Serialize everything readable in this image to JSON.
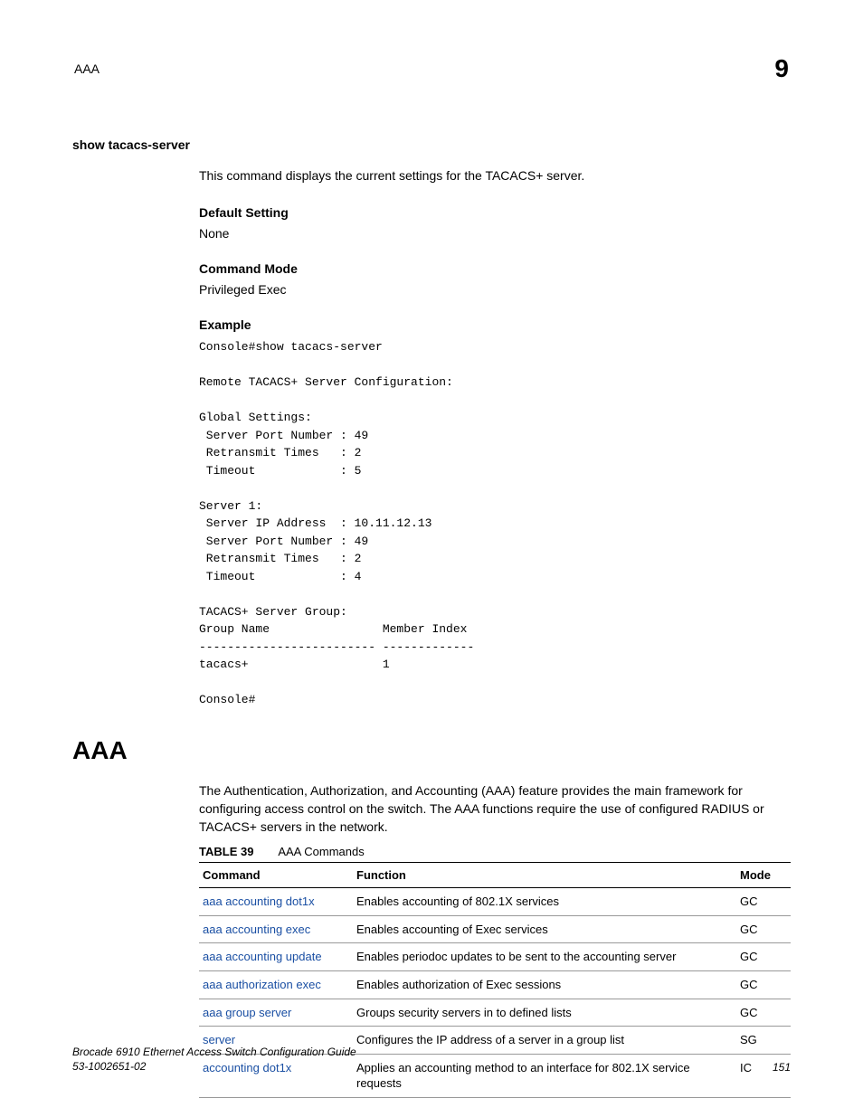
{
  "header": {
    "left": "AAA",
    "right": "9"
  },
  "command": {
    "name": "show tacacs-server",
    "intro": "This command displays the current settings for the TACACS+ server.",
    "default_setting_label": "Default Setting",
    "default_setting_value": "None",
    "command_mode_label": "Command Mode",
    "command_mode_value": "Privileged Exec",
    "example_label": "Example",
    "example_code": "Console#show tacacs-server\n\nRemote TACACS+ Server Configuration:\n\nGlobal Settings:\n Server Port Number : 49\n Retransmit Times   : 2\n Timeout            : 5\n\nServer 1:\n Server IP Address  : 10.11.12.13\n Server Port Number : 49\n Retransmit Times   : 2\n Timeout            : 4\n\nTACACS+ Server Group:\nGroup Name                Member Index\n------------------------- -------------\ntacacs+                   1\n\nConsole#"
  },
  "section": {
    "heading": "AAA",
    "intro": "The Authentication, Authorization, and Accounting (AAA) feature provides the main framework for configuring access control on the switch. The AAA functions require the use of configured RADIUS or TACACS+ servers in the network."
  },
  "table": {
    "caption_label": "TABLE 39",
    "caption_text": "AAA Commands",
    "headers": {
      "command": "Command",
      "function": "Function",
      "mode": "Mode"
    },
    "rows": [
      {
        "command": "aaa accounting dot1x",
        "function": "Enables accounting of 802.1X services",
        "mode": "GC"
      },
      {
        "command": "aaa accounting exec",
        "function": "Enables accounting of Exec services",
        "mode": "GC"
      },
      {
        "command": "aaa accounting update",
        "function": "Enables periodoc updates to be sent to the accounting server",
        "mode": "GC"
      },
      {
        "command": "aaa authorization exec",
        "function": "Enables authorization of Exec sessions",
        "mode": "GC"
      },
      {
        "command": "aaa group server",
        "function": "Groups security servers in to defined lists",
        "mode": "GC"
      },
      {
        "command": "server",
        "function": "Configures the IP address of a server in a group list",
        "mode": "SG"
      },
      {
        "command": "accounting dot1x",
        "function": "Applies an accounting method to an interface for 802.1X service requests",
        "mode": "IC"
      }
    ]
  },
  "footer": {
    "guide": "Brocade 6910 Ethernet Access Switch Configuration Guide",
    "docnum": "53-1002651-02",
    "page": "151"
  }
}
